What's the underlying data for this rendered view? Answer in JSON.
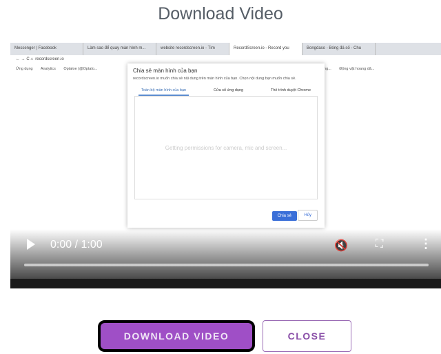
{
  "title": "Download Video",
  "video": {
    "browser_tabs": [
      "Messenger | Facebook",
      "Làm sao để quay màn hình m...",
      "website recordscreen.io - Tìm",
      "RecordScreen.io - Record you",
      "Bongdaso - Bóng đá số - Chu"
    ],
    "address": "recordscreen.io",
    "bookmarks": [
      "Ứng dụng",
      "Analytics",
      "Optaloe (@Optalo...",
      "Thoại di động...",
      "Động vật hoang dã..."
    ],
    "dialog": {
      "title": "Chia sẻ màn hình của bạn",
      "description": "recordscreen.io muốn chia sẻ nội dung trên màn hình của bạn. Chọn nội dung bạn muốn chia sẻ.",
      "tabs": [
        "Toàn bộ màn hình của bạn",
        "Cửa sổ ứng dụng",
        "Thẻ trình duyệt Chrome"
      ],
      "status": "Getting permissions for camera, mic and screen...",
      "share_label": "Chia sẻ",
      "cancel_label": "Hủy"
    },
    "time": "0:00 / 1:00",
    "progress": 0
  },
  "buttons": {
    "download": "DOWNLOAD VIDEO",
    "close": "CLOSE"
  },
  "colors": {
    "accent": "#9f4fc6"
  }
}
